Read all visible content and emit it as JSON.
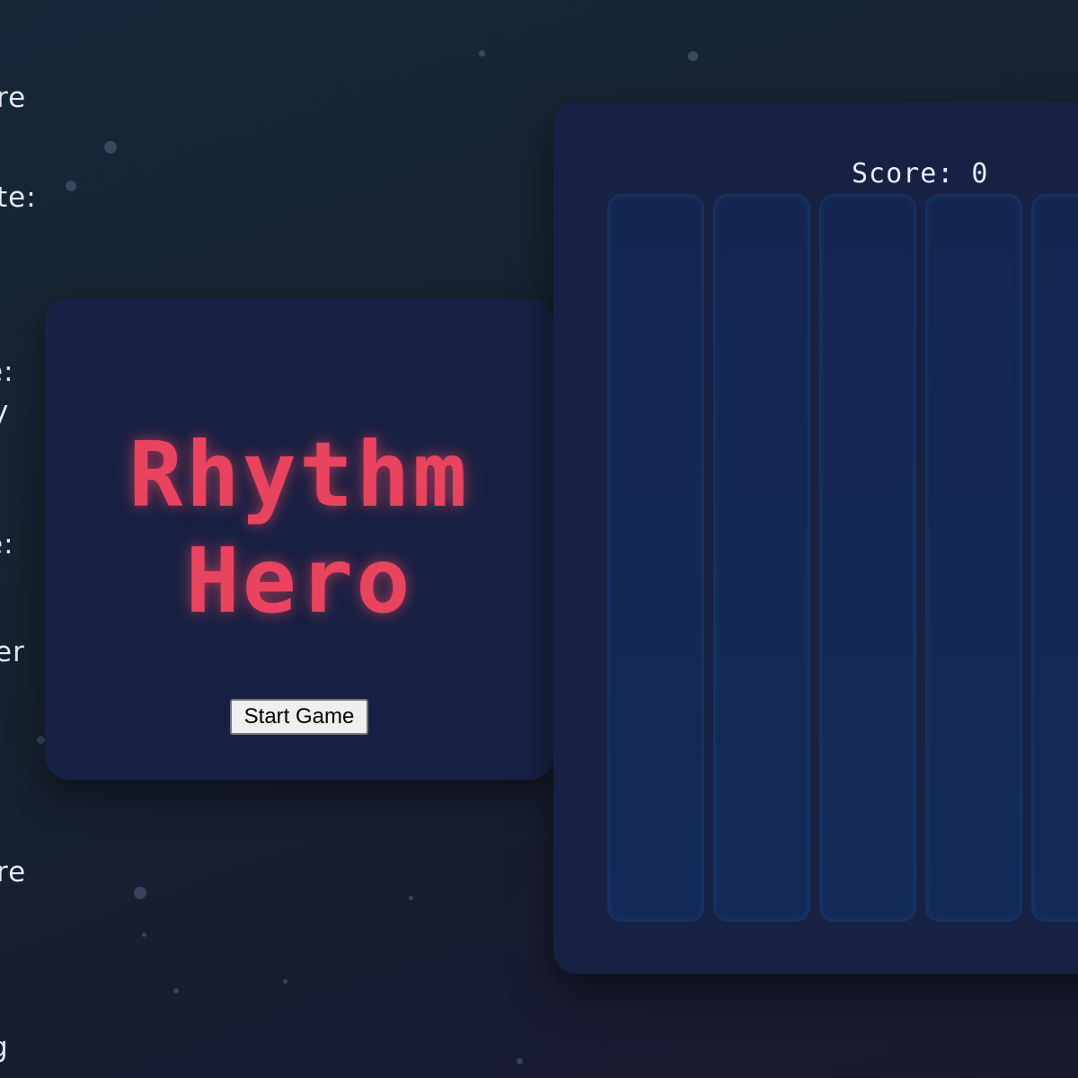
{
  "background_fragments": [
    "re",
    "te:",
    "e:",
    "y",
    "e:",
    "er",
    "re",
    "g"
  ],
  "title_panel": {
    "title_line1": "Rhythm",
    "title_line2": "Hero",
    "start_button_label": "Start Game"
  },
  "game_board": {
    "score_label": "Score: 0",
    "lanes": [
      "lane-1",
      "lane-2",
      "lane-3",
      "lane-4",
      "lane-5"
    ]
  },
  "colors": {
    "title_accent": "#e8445f",
    "panel_bg": "#172143",
    "lane_bg": "#132a58"
  }
}
